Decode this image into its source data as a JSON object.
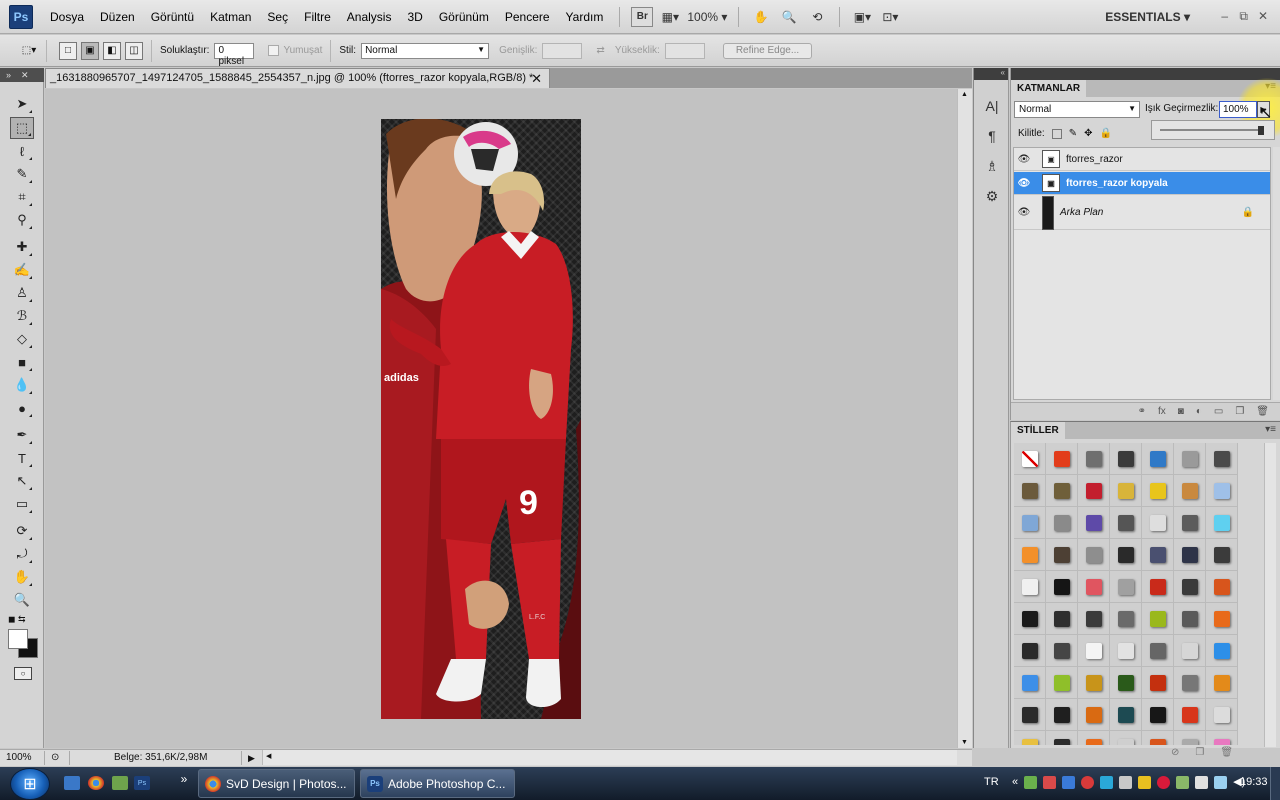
{
  "app": {
    "logo": "Ps",
    "menu": [
      "Dosya",
      "Düzen",
      "Görüntü",
      "Katman",
      "Seç",
      "Filtre",
      "Analysis",
      "3D",
      "Görünüm",
      "Pencere",
      "Yardım"
    ],
    "bridge_btn": "Br",
    "zoom_menu": "100%",
    "workspace": "ESSENTIALS",
    "win_min": "–",
    "win_max": "⧉",
    "win_close": "✕"
  },
  "options": {
    "feather_label": "Soluklaştır:",
    "feather_value": "0 piksel",
    "antialias_label": "Yumuşat",
    "style_label": "Stil:",
    "style_value": "Normal",
    "width_label": "Genişlik:",
    "height_label": "Yükseklik:",
    "refine_button": "Refine Edge..."
  },
  "document": {
    "tab_title": "_1631880965707_1497124705_1588845_2554357_n.jpg @ 100% (ftorres_razor kopyala,RGB/8) *",
    "tab_close": "✕",
    "close_toolbar": "✕",
    "toolbar_expand": "»",
    "zoom_status": "100%",
    "doc_info": "Belge: 351,6K/2,98M",
    "image_text": {
      "number": "9",
      "club": "L.F.C",
      "sponsor": "adidas"
    }
  },
  "layers_panel": {
    "title": "KATMANLAR",
    "blend_mode": "Normal",
    "opacity_label": "Işık Geçirmezlik:",
    "opacity_value": "100%",
    "lock_label": "Kilitle:",
    "layers": [
      {
        "name": "ftorres_razor",
        "selected": false
      },
      {
        "name": "ftorres_razor kopyala",
        "selected": true
      },
      {
        "name": "Arka Plan",
        "selected": false,
        "locked": true
      }
    ]
  },
  "styles_panel": {
    "title": "STİLLER",
    "swatch_colors": [
      "#ffffff",
      "#e23c1a",
      "#6f6f6f",
      "#3a3a3a",
      "#2f79c7",
      "#9a9a9a",
      "#4a4a4a",
      "#6b5a3c",
      "#6f5f3a",
      "#c31e2e",
      "#d8b43a",
      "#e8c51c",
      "#c9893f",
      "#9fc0e8",
      "#7fa7d6",
      "#8a8a8a",
      "#5e4aa8",
      "#555555",
      "#dedede",
      "#5c5c5c",
      "#5fd0f0",
      "#f3902a",
      "#4d4034",
      "#8e8e8e",
      "#2a2a2a",
      "#4a5070",
      "#2e3448",
      "#3b3b3b",
      "#f0f0f0",
      "#151515",
      "#e05560",
      "#a0a0a0",
      "#c92a1a",
      "#3a3a3a",
      "#d8551c",
      "#1a1a1a",
      "#2e2e2e",
      "#3a3a3a",
      "#6a6a6a",
      "#9ab81c",
      "#5a5a5a",
      "#e86a1a",
      "#2a2a2a",
      "#454545",
      "#f4f4f4",
      "#e2e2e2",
      "#666666",
      "#d6d6d6",
      "#2d8fe8",
      "#3d8fe8",
      "#8fbf2a",
      "#c8941a",
      "#2a5a1a",
      "#c4300f",
      "#777777",
      "#e38a1a",
      "#2b2b2b",
      "#1f1f1f",
      "#d96a12",
      "#1d4a52",
      "#171717",
      "#d8351a",
      "#dcdcdc",
      "#e8c040",
      "#2b2b2b",
      "#e86a1a",
      "#cfcfcf",
      "#d8551c",
      "#aaaaaa",
      "#e878c0"
    ]
  },
  "taskbar": {
    "start": "⊞",
    "chrome_task": "SvD Design | Photos...",
    "ps_task": "Adobe Photoshop C...",
    "lang": "TR",
    "expand": "«",
    "clock": "19:33"
  }
}
